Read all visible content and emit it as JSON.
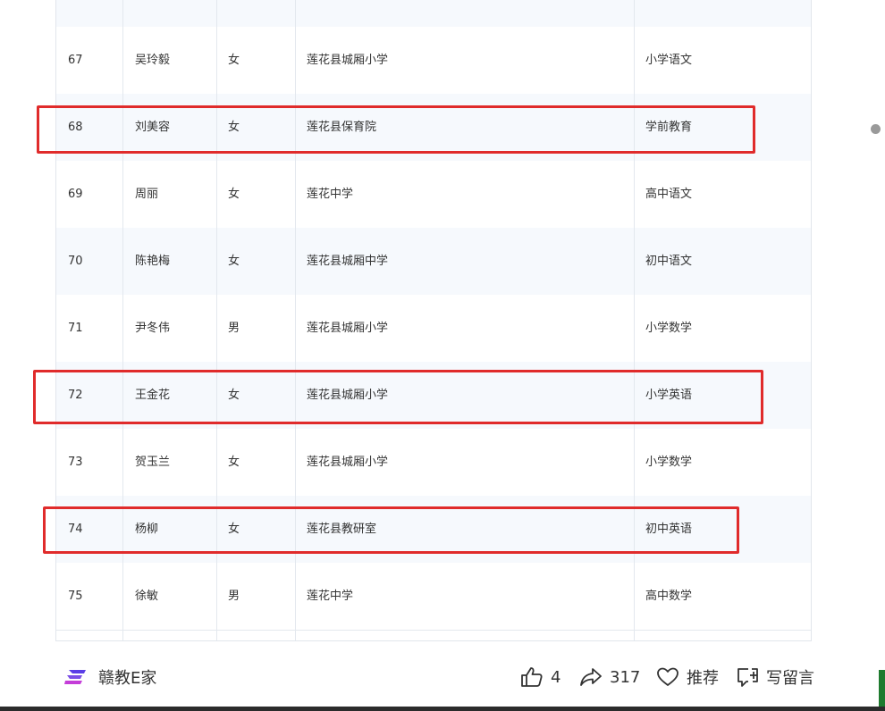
{
  "table": {
    "rows": [
      {
        "no": "",
        "name": "",
        "gender": "",
        "unit": "",
        "subject": ""
      },
      {
        "no": "67",
        "name": "吴玲毅",
        "gender": "女",
        "unit": "莲花县城厢小学",
        "subject": "小学语文"
      },
      {
        "no": "68",
        "name": "刘美容",
        "gender": "女",
        "unit": "莲花县保育院",
        "subject": "学前教育"
      },
      {
        "no": "69",
        "name": "周丽",
        "gender": "女",
        "unit": "莲花中学",
        "subject": "高中语文"
      },
      {
        "no": "70",
        "name": "陈艳梅",
        "gender": "女",
        "unit": "莲花县城厢中学",
        "subject": "初中语文"
      },
      {
        "no": "71",
        "name": "尹冬伟",
        "gender": "男",
        "unit": "莲花县城厢小学",
        "subject": "小学数学"
      },
      {
        "no": "72",
        "name": "王金花",
        "gender": "女",
        "unit": "莲花县城厢小学",
        "subject": "小学英语"
      },
      {
        "no": "73",
        "name": "贺玉兰",
        "gender": "女",
        "unit": "莲花县城厢小学",
        "subject": "小学数学"
      },
      {
        "no": "74",
        "name": "杨柳",
        "gender": "女",
        "unit": "莲花县教研室",
        "subject": "初中英语"
      },
      {
        "no": "75",
        "name": "徐敏",
        "gender": "男",
        "unit": "莲花中学",
        "subject": "高中数学"
      }
    ]
  },
  "footer": {
    "brand_name": "赣教E家",
    "like_count": "4",
    "share_count": "317",
    "recommend_label": "推荐",
    "comment_label": "写留言"
  },
  "colors": {
    "highlight": "#e02b2b",
    "brand_purple": "#5a3ee6",
    "brand_pink": "#c43dd8",
    "row_alt": "#f6f9fd",
    "grid": "#e3e8ee"
  },
  "icons": {
    "brand": "brand-logo-icon",
    "like": "thumbs-up-icon",
    "share": "share-arrow-icon",
    "recommend": "heart-icon",
    "comment": "comment-plus-icon"
  }
}
